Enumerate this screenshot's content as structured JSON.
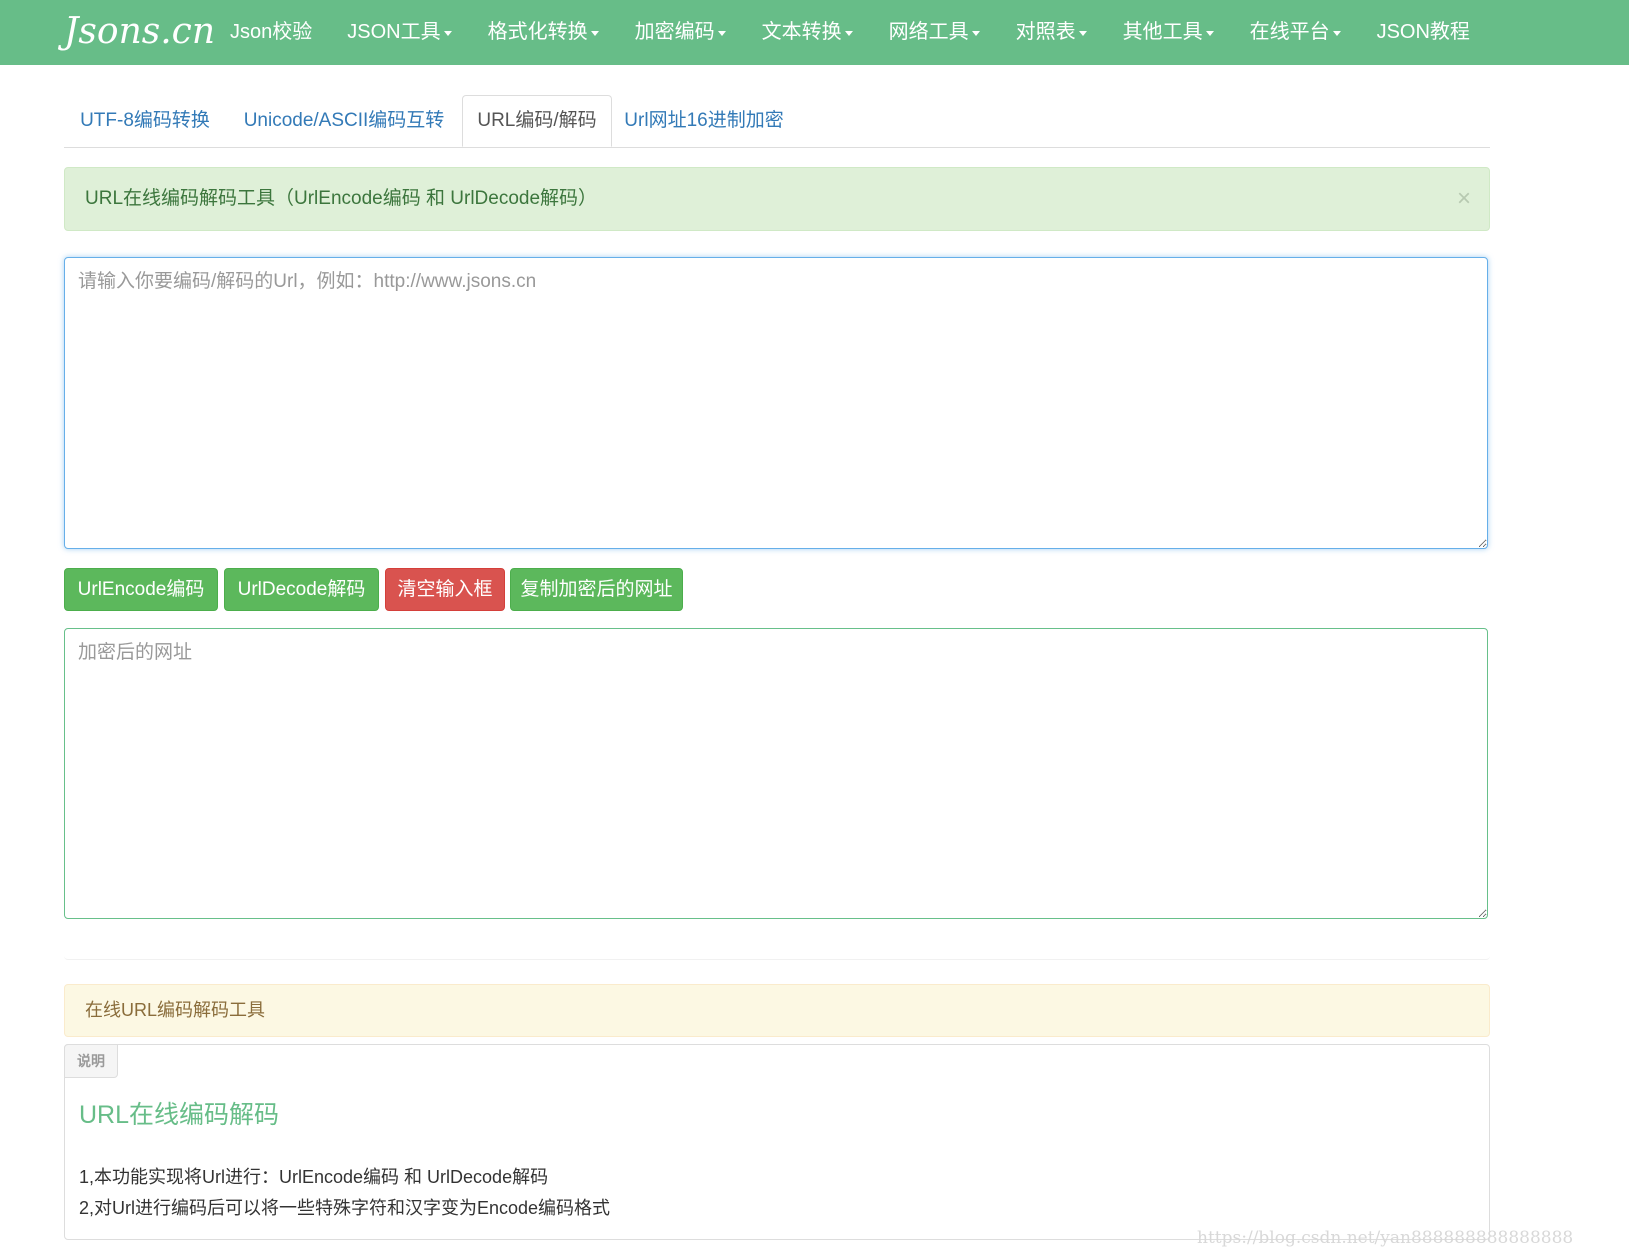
{
  "navbar": {
    "brand": "Jsons.cn",
    "items": [
      {
        "label": "Json校验",
        "dropdown": false
      },
      {
        "label": "JSON工具",
        "dropdown": true
      },
      {
        "label": "格式化转换",
        "dropdown": true
      },
      {
        "label": "加密编码",
        "dropdown": true
      },
      {
        "label": "文本转换",
        "dropdown": true
      },
      {
        "label": "网络工具",
        "dropdown": true
      },
      {
        "label": "对照表",
        "dropdown": true
      },
      {
        "label": "其他工具",
        "dropdown": true
      },
      {
        "label": "在线平台",
        "dropdown": true
      },
      {
        "label": "JSON教程",
        "dropdown": false
      }
    ]
  },
  "tabs": [
    {
      "label": "UTF-8编码转换",
      "active": false
    },
    {
      "label": "Unicode/ASCII编码互转",
      "active": false
    },
    {
      "label": "URL编码/解码",
      "active": true
    },
    {
      "label": "Url网址16进制加密",
      "active": false
    }
  ],
  "alert": {
    "text": "URL在线编码解码工具（UrlEncode编码 和 UrlDecode解码）",
    "close": "×"
  },
  "input": {
    "placeholder": "请输入你要编码/解码的Url，例如：http://www.jsons.cn",
    "value": ""
  },
  "buttons": {
    "encode": "UrlEncode编码",
    "decode": "UrlDecode解码",
    "clear": "清空输入框",
    "copy": "复制加密后的网址"
  },
  "output": {
    "placeholder": "加密后的网址",
    "value": ""
  },
  "info_alert": {
    "text": "在线URL编码解码工具"
  },
  "doc": {
    "label": "说明",
    "heading": "URL在线编码解码",
    "lines": [
      "1,本功能实现将Url进行：UrlEncode编码 和 UrlDecode解码",
      "2,对Url进行编码后可以将一些特殊字符和汉字变为Encode编码格式"
    ]
  },
  "watermark": "https://blog.csdn.net/yan888888888888888",
  "colors": {
    "navbar": "#67bd88",
    "link": "#337ab7",
    "success_bg": "#dff0d8",
    "warning_bg": "#fcf8e3",
    "button_green": "#5cb85c",
    "button_red": "#d9534f"
  }
}
